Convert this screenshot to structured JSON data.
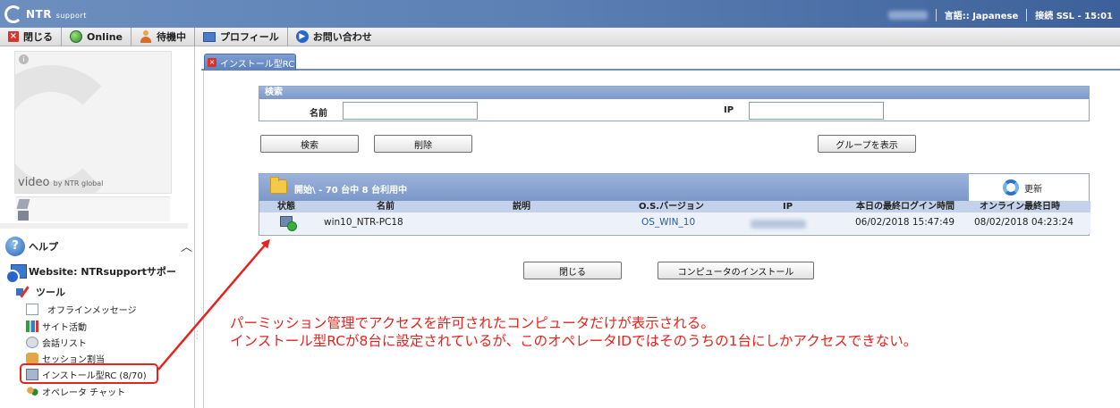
{
  "header": {
    "logo_brand": "NTR",
    "logo_sub": "support",
    "language": "言語:: Japanese",
    "connection": "接続 SSL - 15:01"
  },
  "toolbar": {
    "close_label": "閉じる",
    "online_label": "Online",
    "standby_label": "待機中",
    "profile_label": "プロフィール",
    "contact_label": "お問い合わせ"
  },
  "sidebar": {
    "video_label": "video",
    "video_by": "by NTR global",
    "help_label": "ヘルプ",
    "website_label": "Website: NTRsupportサポー",
    "tools_label": "ツール",
    "items": [
      {
        "label": "オフラインメッセージ",
        "icon": "message-icon"
      },
      {
        "label": "サイト活動",
        "icon": "chart-icon"
      },
      {
        "label": "会話リスト",
        "icon": "list-icon"
      },
      {
        "label": "セッション割当",
        "icon": "session-icon"
      },
      {
        "label": "インストール型RC (8/70)",
        "icon": "computer-icon"
      },
      {
        "label": "オペレータ チャット",
        "icon": "chat-icon"
      }
    ]
  },
  "tab": {
    "label": "インストール型RC"
  },
  "search": {
    "header": "検索",
    "name_label": "名前",
    "name_value": "",
    "ip_label": "IP",
    "ip_value": "",
    "search_button": "検索",
    "delete_button": "削除",
    "show_groups_button": "グループを表示"
  },
  "results": {
    "title": "開始\\ - 70 台中 8 台利用中",
    "refresh_label": "更新",
    "columns": [
      "状態",
      "名前",
      "説明",
      "O.S.バージョン",
      "IP",
      "本日の最終ログイン時間",
      "オンライン最終日時"
    ],
    "rows": [
      {
        "name": "win10_NTR-PC18",
        "description": "",
        "os": "OS_WIN_10",
        "last_login": "06/02/2018 15:47:49",
        "last_online": "08/02/2018 04:23:24"
      }
    ]
  },
  "footer_buttons": {
    "close": "閉じる",
    "install": "コンピュータのインストール"
  },
  "annotation": {
    "line1": "パーミッション管理でアクセスを許可されたコンピュータだけが表示される。",
    "line2": "インストール型RCが8台に設定されているが、このオペレータIDではそのうちの1台にしかアクセスできない。"
  },
  "colors": {
    "accent": "#5b7fb4",
    "annotation": "#e8221c"
  }
}
